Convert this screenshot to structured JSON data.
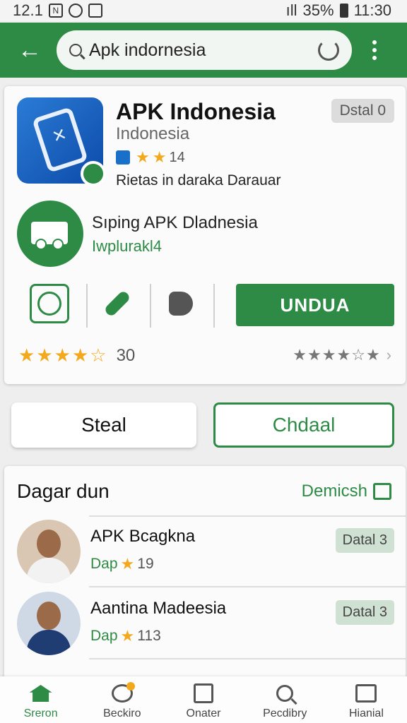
{
  "status_bar": {
    "left_text": "12.1",
    "right_text": "35%",
    "time": "11:30"
  },
  "search": {
    "query": "Apk indornesia"
  },
  "app": {
    "title": "APK Indonesia",
    "subtitle": "Indonesia",
    "chip": "Dstal 0",
    "rating_count": "14",
    "description": "Rietas in daraka Darauar"
  },
  "feature": {
    "title": "Sıping APK Dladnesia",
    "subtitle": "Iwplurakl4"
  },
  "actions": {
    "download_label": "UNDUA"
  },
  "rating": {
    "value": 4.5,
    "count": "30",
    "secondary_value": 3.5
  },
  "buttons": {
    "steal": "Steal",
    "chdaal": "Chdaal"
  },
  "list": {
    "header": "Dagar dun",
    "link": "Demicsh",
    "items": [
      {
        "title": "APK Bcagkna",
        "meta_prefix": "Dap",
        "meta_count": "19",
        "chip": "Datal 3"
      },
      {
        "title": "Aantina Madeesia",
        "meta_prefix": "Dap",
        "meta_count": "113",
        "chip": "Datal 3"
      }
    ]
  },
  "nav": [
    {
      "label": "Sreron",
      "icon": "home-icon",
      "active": true
    },
    {
      "label": "Beckiro",
      "icon": "chat-icon",
      "active": false
    },
    {
      "label": "Onater",
      "icon": "calendar-icon",
      "active": false
    },
    {
      "label": "Pecdibry",
      "icon": "search-icon",
      "active": false
    },
    {
      "label": "Hianial",
      "icon": "box-icon",
      "active": false
    }
  ],
  "colors": {
    "primary": "#2e8b45",
    "star": "#f2a91e"
  }
}
